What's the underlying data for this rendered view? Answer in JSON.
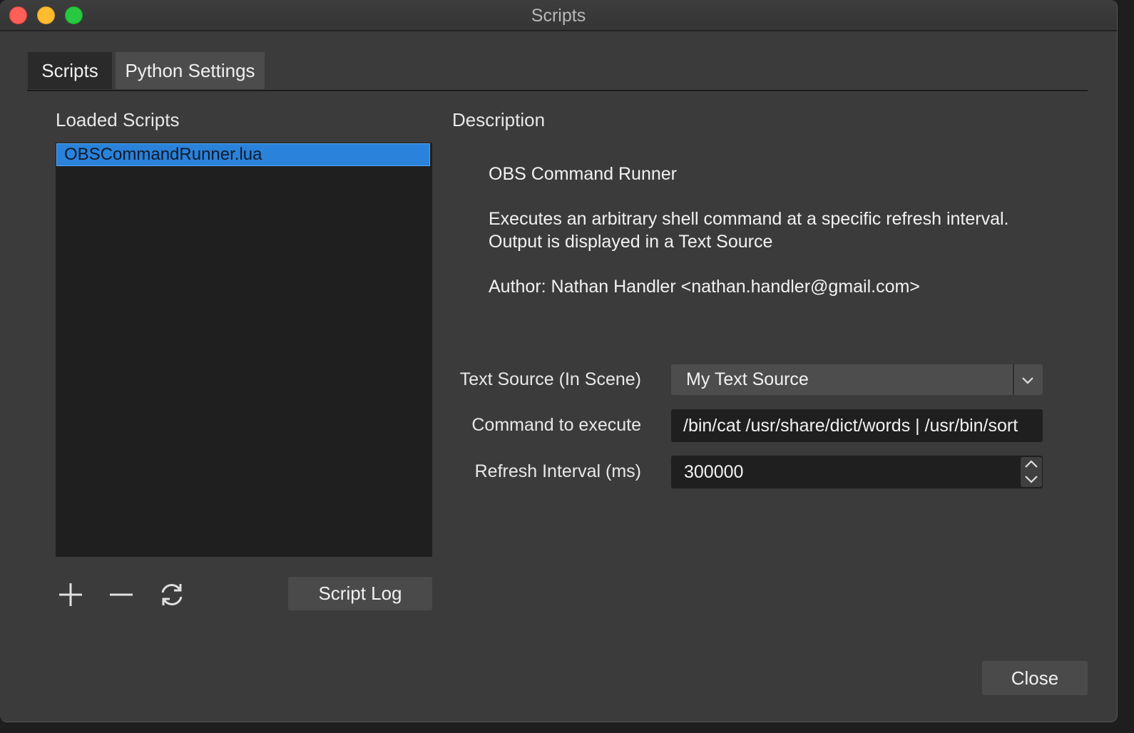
{
  "window": {
    "title": "Scripts"
  },
  "tabs": [
    {
      "label": "Scripts",
      "active": true
    },
    {
      "label": "Python Settings",
      "active": false
    }
  ],
  "loaded_scripts": {
    "label": "Loaded Scripts",
    "items": [
      {
        "name": "OBSCommandRunner.lua",
        "selected": true
      }
    ],
    "toolbar": {
      "add_icon": "plus-icon",
      "remove_icon": "minus-icon",
      "reload_icon": "refresh-icon",
      "script_log_label": "Script Log"
    }
  },
  "description": {
    "label": "Description",
    "title": "OBS Command Runner",
    "line1": "Executes an arbitrary shell command at a specific refresh interval.",
    "line2": "Output is displayed in a Text Source",
    "author": "Author: Nathan Handler <nathan.handler@gmail.com>"
  },
  "settings": {
    "text_source": {
      "label": "Text Source (In Scene)",
      "value": "My Text Source"
    },
    "command": {
      "label": "Command to execute",
      "value": "/bin/cat /usr/share/dict/words | /usr/bin/sort"
    },
    "refresh_interval": {
      "label": "Refresh Interval (ms)",
      "value": "300000"
    }
  },
  "footer": {
    "close_label": "Close"
  },
  "colors": {
    "accent": "#2a82da",
    "window_bg": "#3b3b3b",
    "list_bg": "#1f1f1f",
    "close_dot": "#ff5f57",
    "minimize_dot": "#febc2e",
    "maximize_dot": "#28c840"
  }
}
